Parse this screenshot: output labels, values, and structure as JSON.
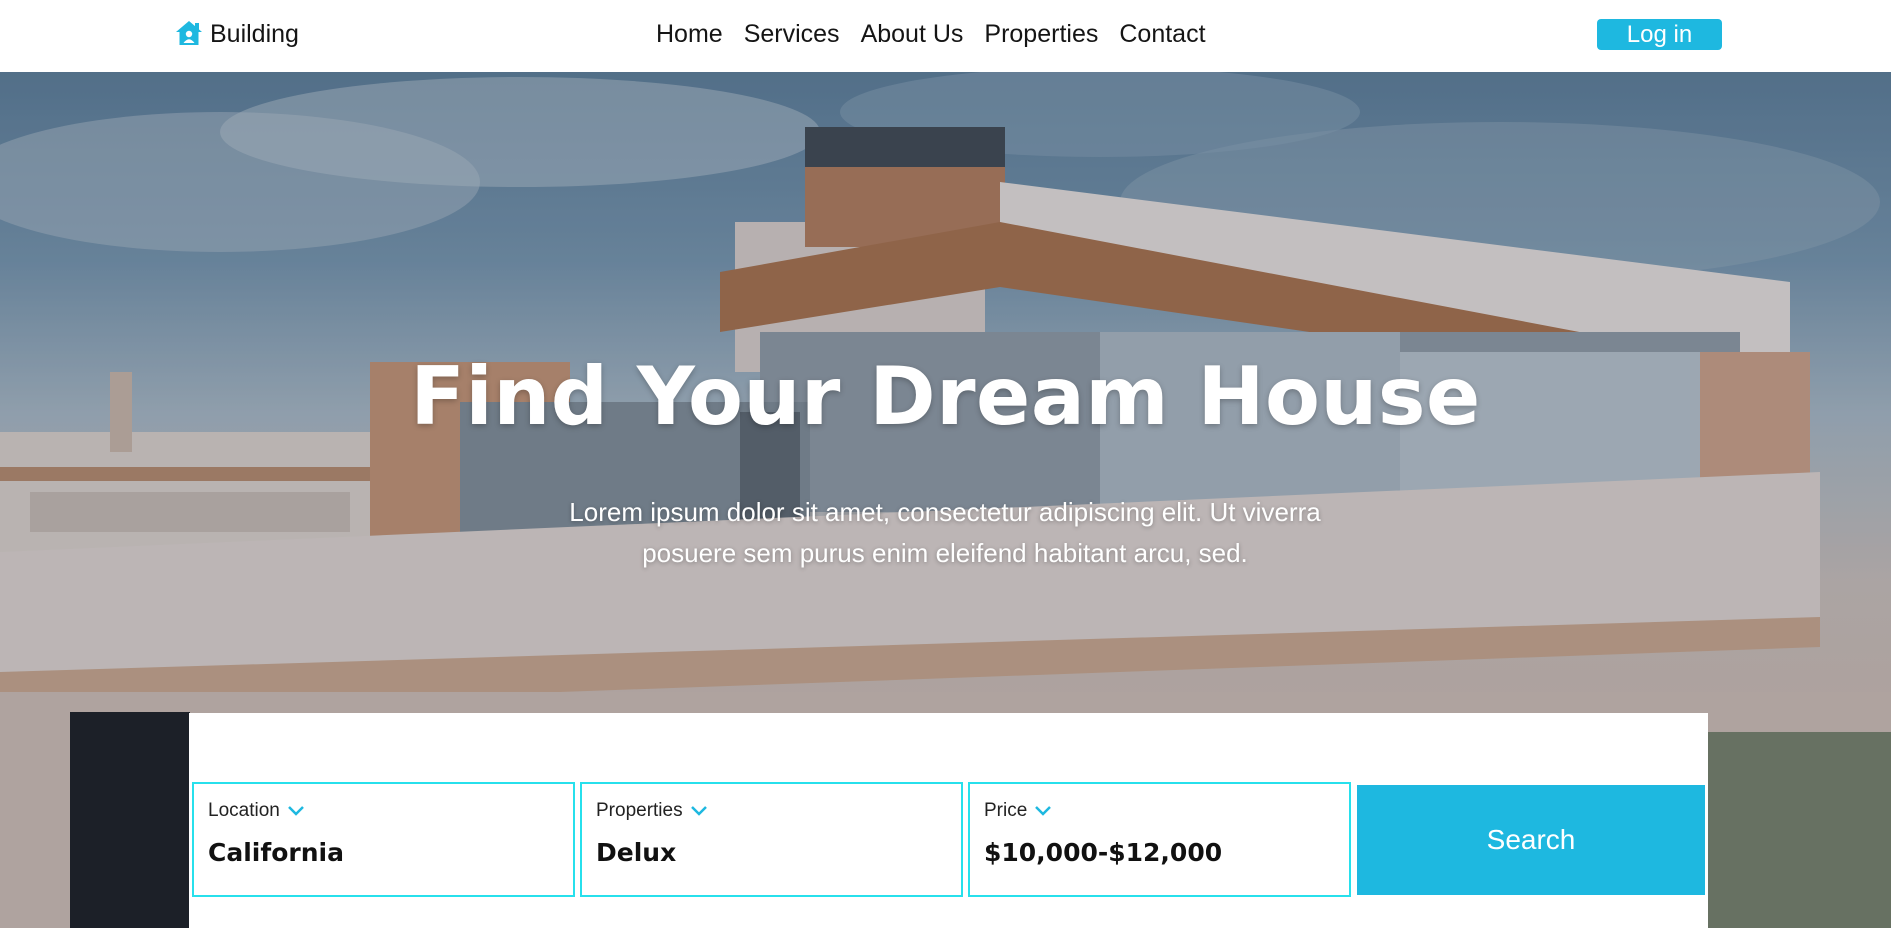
{
  "navbar": {
    "brand_icon": "house-icon",
    "brand_name": "Building",
    "links": [
      "Home",
      "Services",
      "About Us",
      "Properties",
      "Contact"
    ],
    "login_label": "Log in"
  },
  "hero": {
    "title": "Find Your Dream House",
    "subtitle": "Lorem ipsum dolor sit amet, consectetur adipiscing elit. Ut viverra posuere sem purus enim eleifend habitant arcu, sed."
  },
  "search": {
    "fields": [
      {
        "label": "Location",
        "value": "California"
      },
      {
        "label": "Properties",
        "value": "Delux"
      },
      {
        "label": "Price",
        "value": "$10,000-$12,000"
      }
    ],
    "button_label": "Search"
  },
  "colors": {
    "accent": "#1eb8e0",
    "field_border": "#27e0ec"
  }
}
